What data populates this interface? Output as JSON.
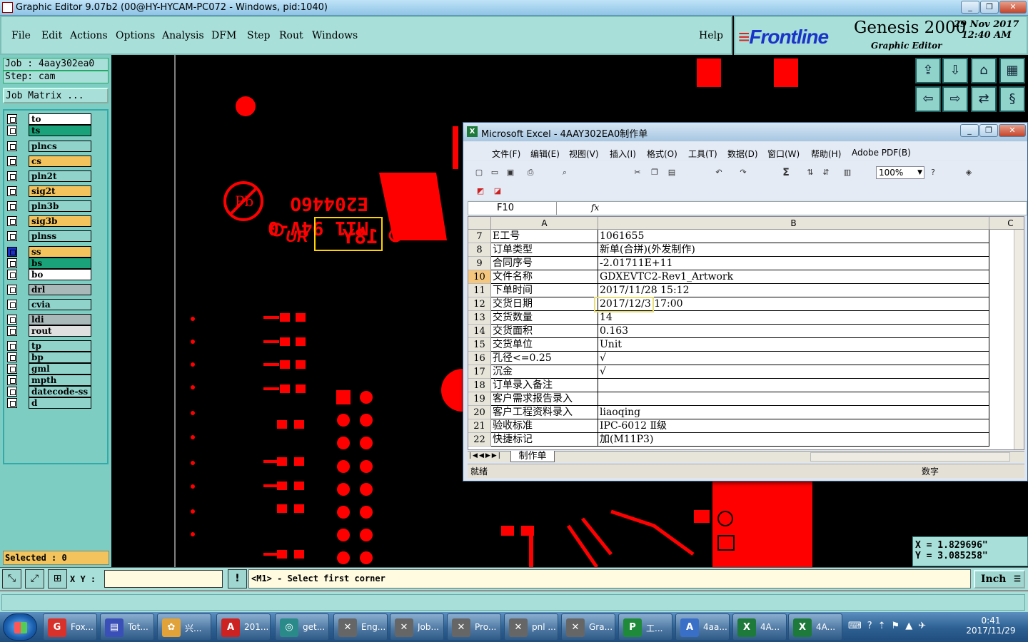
{
  "window": {
    "title": "Graphic Editor 9.07b2 (00@HY-HYCAM-PC072 - Windows, pid:1040)",
    "controls": [
      "_",
      "❐",
      "✕"
    ]
  },
  "menubar": {
    "items": [
      "File",
      "Edit",
      "Actions",
      "Options",
      "Analysis",
      "DFM",
      "Step",
      "Rout",
      "Windows"
    ],
    "help": "Help"
  },
  "brand": {
    "logo": "Frontline",
    "product": "Genesis 2000",
    "subtitle": "Graphic Editor",
    "date": "29 Nov 2017",
    "time": "12:40 AM"
  },
  "left": {
    "job": "Job : 4aay302ea0",
    "step": "Step: cam",
    "job_matrix": "Job Matrix ...",
    "layers": [
      {
        "name": "to",
        "color": "#ffffff"
      },
      {
        "name": "ts",
        "color": "#1aa37a"
      },
      {
        "name": "plncs",
        "color": "#8fd3cb"
      },
      {
        "name": "cs",
        "color": "#f3c45e"
      },
      {
        "name": "pln2t",
        "color": "#8fd3cb"
      },
      {
        "name": "sig2t",
        "color": "#f3c45e"
      },
      {
        "name": "pln3b",
        "color": "#8fd3cb"
      },
      {
        "name": "sig3b",
        "color": "#f3c45e"
      },
      {
        "name": "plnss",
        "color": "#8fd3cb"
      },
      {
        "name": "ss",
        "color": "#f3c45e"
      },
      {
        "name": "bs",
        "color": "#1aa37a"
      },
      {
        "name": "bo",
        "color": "#ffffff"
      },
      {
        "name": "drl",
        "color": "#a9b8b8"
      },
      {
        "name": "cvia",
        "color": "#8fd3cb"
      },
      {
        "name": "ldi",
        "color": "#a9b8b8"
      },
      {
        "name": "rout",
        "color": "#e0e0e0"
      },
      {
        "name": "tp",
        "color": "#8fd3cb"
      },
      {
        "name": "bp",
        "color": "#8fd3cb"
      },
      {
        "name": "gml",
        "color": "#8fd3cb"
      },
      {
        "name": "mpth",
        "color": "#8fd3cb"
      },
      {
        "name": "datecode-ss",
        "color": "#8fd3cb"
      },
      {
        "name": "d",
        "color": "#8fd3cb"
      }
    ],
    "selected": "Selected : 0"
  },
  "canvas": {
    "text1": "E20446O",
    "text2": "M11 94V-0",
    "text3": "18Y",
    "text4": "Pb",
    "text5": "UR"
  },
  "coords": {
    "x": "X = 1.829696\"",
    "y": "Y = 3.085258\""
  },
  "cmd": {
    "xy_label": "X Y :",
    "xy_value": "",
    "message": "<M1> - Select first corner",
    "units": "Inch"
  },
  "excel": {
    "title": "Microsoft Excel - 4AAY302EA0制作单",
    "menus": [
      "文件(F)",
      "编辑(E)",
      "视图(V)",
      "插入(I)",
      "格式(O)",
      "工具(T)",
      "数据(D)",
      "窗口(W)",
      "帮助(H)",
      "Adobe PDF(B)"
    ],
    "zoom": "100%",
    "namebox": "F10",
    "fx": "fx",
    "col_headers": [
      "A",
      "B",
      "C"
    ],
    "rows": [
      {
        "n": "7",
        "a": "E工号",
        "b": "1061655"
      },
      {
        "n": "8",
        "a": "订单类型",
        "b": "新单(合拼)(外发制作)"
      },
      {
        "n": "9",
        "a": "合同序号",
        "b": "-2.01711E+11"
      },
      {
        "n": "10",
        "a": "文件名称",
        "b": "GDXEVTC2-Rev1_Artwork"
      },
      {
        "n": "11",
        "a": "下单时间",
        "b": "2017/11/28 15:12"
      },
      {
        "n": "12",
        "a": "交货日期",
        "b": "2017/12/3 17:00"
      },
      {
        "n": "13",
        "a": "交货数量",
        "b": "14"
      },
      {
        "n": "14",
        "a": "交货面积",
        "b": "0.163"
      },
      {
        "n": "15",
        "a": "交货单位",
        "b": "Unit"
      },
      {
        "n": "16",
        "a": "孔径<=0.25",
        "b": "√"
      },
      {
        "n": "17",
        "a": "沉金",
        "b": "√"
      },
      {
        "n": "18",
        "a": "订单录入备注",
        "b": ""
      },
      {
        "n": "19",
        "a": "客户需求报告录入",
        "b": ""
      },
      {
        "n": "20",
        "a": "客户工程资料录入",
        "b": "liaoqing"
      },
      {
        "n": "21",
        "a": "验收标准",
        "b": "IPC-6012 Ⅱ级"
      },
      {
        "n": "22",
        "a": "快捷标记",
        "b": "加(M11P3)"
      }
    ],
    "sheet_tab": "制作单",
    "status_left": "就绪",
    "status_num": "数字"
  },
  "taskbar": {
    "items": [
      {
        "label": "Fox...",
        "color": "#d8302a",
        "glyph": "G"
      },
      {
        "label": "Tot...",
        "color": "#3a4fb8",
        "glyph": "▤"
      },
      {
        "label": "兴...",
        "color": "#e1a23a",
        "glyph": "✿"
      },
      {
        "label": "201...",
        "color": "#c22",
        "glyph": "A"
      },
      {
        "label": "get...",
        "color": "#2a8a8a",
        "glyph": "◎"
      },
      {
        "label": "Eng...",
        "color": "#666",
        "glyph": "✕"
      },
      {
        "label": "Job...",
        "color": "#666",
        "glyph": "✕"
      },
      {
        "label": "Pro...",
        "color": "#666",
        "glyph": "✕"
      },
      {
        "label": "pnl ...",
        "color": "#666",
        "glyph": "✕"
      },
      {
        "label": "Gra...",
        "color": "#666",
        "glyph": "✕"
      },
      {
        "label": "工...",
        "color": "#1e8a3a",
        "glyph": "P"
      },
      {
        "label": "4aa...",
        "color": "#3a6fc8",
        "glyph": "A"
      },
      {
        "label": "4A...",
        "color": "#1e7a3a",
        "glyph": "X"
      },
      {
        "label": "4A...",
        "color": "#1e7a3a",
        "glyph": "X"
      }
    ],
    "time": "0:41",
    "date": "2017/11/29"
  }
}
